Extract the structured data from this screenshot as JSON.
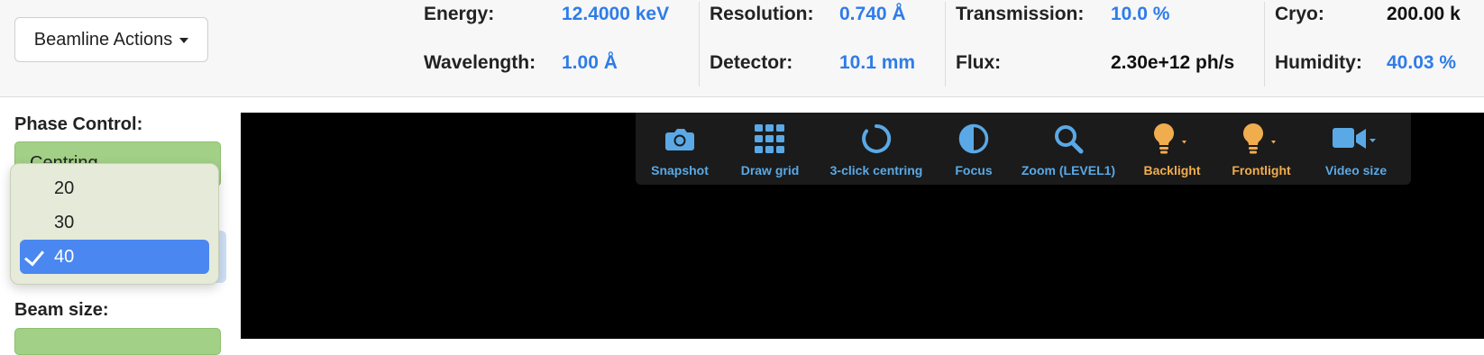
{
  "header": {
    "beamline_actions_label": "Beamline Actions",
    "stats": {
      "energy": {
        "label": "Energy:",
        "value": "12.4000 keV"
      },
      "wavelength": {
        "label": "Wavelength:",
        "value": "1.00 Å"
      },
      "resolution": {
        "label": "Resolution:",
        "value": "0.740 Å"
      },
      "detector": {
        "label": "Detector:",
        "value": "10.1 mm"
      },
      "transmission": {
        "label": "Transmission:",
        "value": "10.0 %"
      },
      "flux": {
        "label": "Flux:",
        "value": "2.30e+12 ph/s"
      },
      "cryo": {
        "label": "Cryo:",
        "value": "200.00 k"
      },
      "humidity": {
        "label": "Humidity:",
        "value": "40.03 %"
      }
    }
  },
  "sidebar": {
    "phase_label": "Phase Control:",
    "phase_value": "Centring",
    "beam_label": "Beam size:",
    "dropdown": {
      "options": [
        "20",
        "30",
        "40"
      ],
      "selected": "40"
    }
  },
  "toolbar": {
    "snapshot": "Snapshot",
    "draw_grid": "Draw grid",
    "three_click": "3-click centring",
    "focus": "Focus",
    "zoom": "Zoom (LEVEL1)",
    "backlight": "Backlight",
    "frontlight": "Frontlight",
    "video_size": "Video size"
  },
  "colors": {
    "accent_blue": "#2f7ce8",
    "icon_blue": "#5aa9e6",
    "icon_orange": "#f0ad4e",
    "phase_green": "#a3d087",
    "selected_blue": "#4a87f0"
  }
}
